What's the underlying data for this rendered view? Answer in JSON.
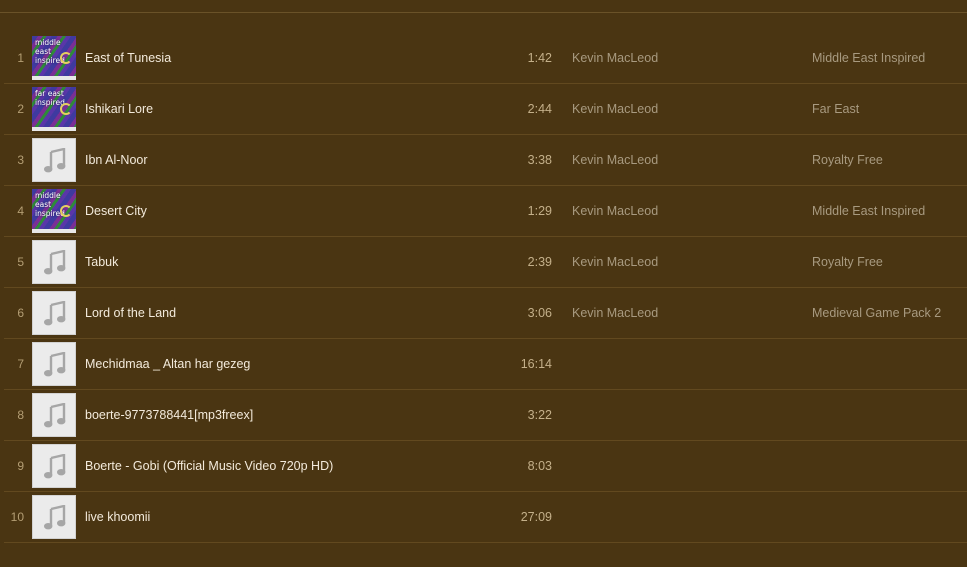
{
  "colors": {
    "background": "#4a3512",
    "divider": "#62491f",
    "title_text": "#f3eadb",
    "secondary_text": "#a89a80"
  },
  "tracks": [
    {
      "number": "1",
      "title": "East of Tunesia",
      "time": "1:42",
      "artist": "Kevin MacLeod",
      "album": "Middle East Inspired",
      "artwork": "album-cover",
      "cover_text": "middle east inspired"
    },
    {
      "number": "2",
      "title": "Ishikari Lore",
      "time": "2:44",
      "artist": "Kevin MacLeod",
      "album": "Far East",
      "artwork": "album-cover",
      "cover_text": "far east inspired"
    },
    {
      "number": "3",
      "title": "Ibn Al-Noor",
      "time": "3:38",
      "artist": "Kevin MacLeod",
      "album": "Royalty Free",
      "artwork": "music-note-icon"
    },
    {
      "number": "4",
      "title": "Desert City",
      "time": "1:29",
      "artist": "Kevin MacLeod",
      "album": "Middle East Inspired",
      "artwork": "album-cover",
      "cover_text": "middle east inspired"
    },
    {
      "number": "5",
      "title": "Tabuk",
      "time": "2:39",
      "artist": "Kevin MacLeod",
      "album": "Royalty Free",
      "artwork": "music-note-icon"
    },
    {
      "number": "6",
      "title": "Lord of the Land",
      "time": "3:06",
      "artist": "Kevin MacLeod",
      "album": "Medieval Game Pack 2",
      "artwork": "music-note-icon"
    },
    {
      "number": "7",
      "title": "Mechidmaa _ Altan har gezeg",
      "time": "16:14",
      "artist": "",
      "album": "",
      "artwork": "music-note-icon"
    },
    {
      "number": "8",
      "title": "boerte-9773788441[mp3freex]",
      "time": "3:22",
      "artist": "",
      "album": "",
      "artwork": "music-note-icon"
    },
    {
      "number": "9",
      "title": "Boerte - Gobi (Official Music Video 720p HD)",
      "time": "8:03",
      "artist": "",
      "album": "",
      "artwork": "music-note-icon"
    },
    {
      "number": "10",
      "title": "live khoomii",
      "time": "27:09",
      "artist": "",
      "album": "",
      "artwork": "music-note-icon"
    }
  ]
}
